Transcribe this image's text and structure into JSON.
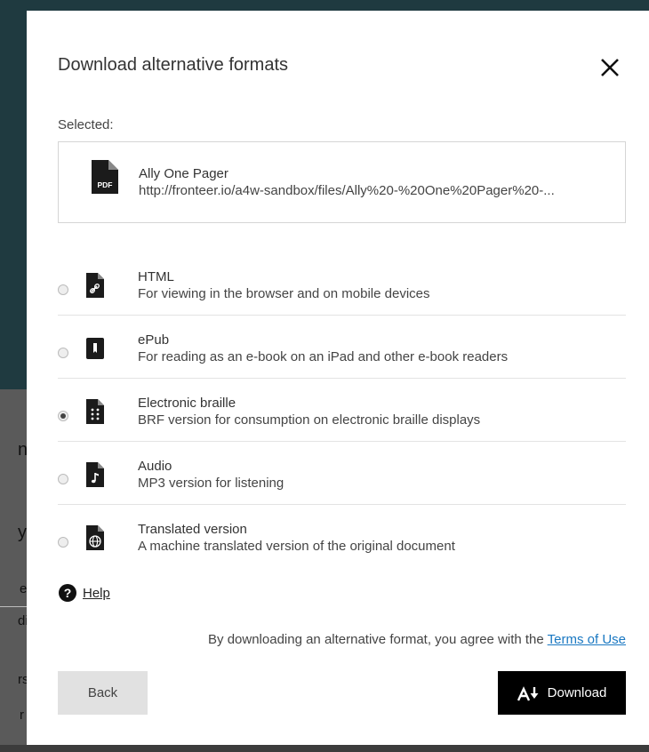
{
  "modal": {
    "title": "Download alternative formats",
    "close_icon": "close-icon",
    "selected_label": "Selected:",
    "selected_file": {
      "icon": "pdf-file-icon",
      "icon_text": "PDF",
      "name": "Ally One Pager",
      "url": "http://fronteer.io/a4w-sandbox/files/Ally%20-%20One%20Pager%20-..."
    },
    "options": [
      {
        "icon": "html-link-file-icon",
        "title": "HTML",
        "description": "For viewing in the browser and on mobile devices",
        "checked": false
      },
      {
        "icon": "epub-book-icon",
        "title": "ePub",
        "description": "For reading as an e-book on an iPad and other e-book readers",
        "checked": false
      },
      {
        "icon": "braille-file-icon",
        "title": "Electronic braille",
        "description": "BRF version for consumption on electronic braille displays",
        "checked": true
      },
      {
        "icon": "audio-file-icon",
        "title": "Audio",
        "description": "MP3 version for listening",
        "checked": false
      },
      {
        "icon": "translated-globe-file-icon",
        "title": "Translated version",
        "description": "A machine translated version of the original document",
        "checked": false
      }
    ],
    "help": {
      "icon": "question-circle-icon",
      "label": "Help"
    },
    "agreement": {
      "text": "By downloading an alternative format, you agree with the ",
      "link": "Terms of Use"
    },
    "back_label": "Back",
    "download_label": "Download",
    "download_icon": "ally-download-icon"
  },
  "background": {
    "partial_letters": [
      "n",
      "y",
      "e",
      "di",
      "rs",
      "r"
    ]
  },
  "colors": {
    "link": "#1a78c2",
    "primary_button": "#000000",
    "secondary_button": "#e1e1e1",
    "page_background": "#1f3a40"
  }
}
